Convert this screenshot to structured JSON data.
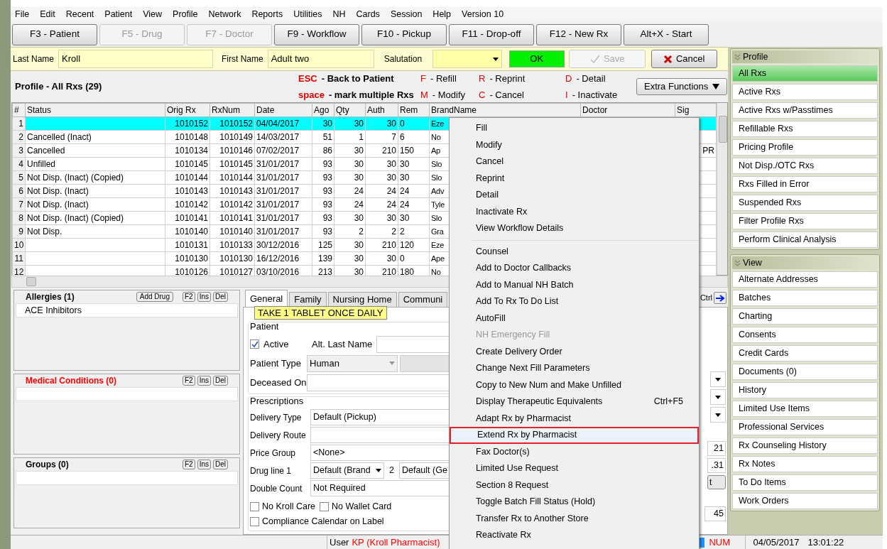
{
  "menu_bar": [
    "File",
    "Edit",
    "Recent",
    "Patient",
    "View",
    "Profile",
    "Network",
    "Reports",
    "Utilities",
    "NH",
    "Cards",
    "Session",
    "Help",
    "Version 10"
  ],
  "toolbar": [
    {
      "label": "F3 - Patient",
      "disabled": false
    },
    {
      "label": "F5 - Drug",
      "disabled": true
    },
    {
      "label": "F7 - Doctor",
      "disabled": true
    },
    {
      "label": "F9 - Workflow",
      "disabled": false
    },
    {
      "label": "F10 - Pickup",
      "disabled": false
    },
    {
      "label": "F11 - Drop-off",
      "disabled": false
    },
    {
      "label": "F12 - New Rx",
      "disabled": false
    },
    {
      "label": "Alt+X - Start",
      "disabled": false
    }
  ],
  "patient_bar": {
    "last_name_label": "Last Name",
    "last_name": "Kroll",
    "first_name_label": "First Name",
    "first_name": "Adult two",
    "salutation_label": "Salutation",
    "ok": "OK",
    "save": {
      "label": "Save",
      "disabled": true
    },
    "cancel": "Cancel"
  },
  "profile_title": "Profile - All Rxs (29)",
  "shortcuts": [
    {
      "key": "ESC",
      "label": "- Back to Patient",
      "bold": true
    },
    {
      "key": "F",
      "label": "- Refill",
      "bold": false
    },
    {
      "key": "R",
      "label": "- Reprint",
      "bold": false
    },
    {
      "key": "D",
      "label": "- Detail",
      "bold": false
    },
    {
      "key": "space",
      "label": "- mark multiple Rxs",
      "bold": true
    },
    {
      "key": "M",
      "label": "- Modify",
      "bold": false
    },
    {
      "key": "C",
      "label": "- Cancel",
      "bold": false
    },
    {
      "key": "I",
      "label": "- Inactivate",
      "bold": false
    }
  ],
  "extra_functions": "Extra Functions",
  "table": {
    "columns": [
      "#",
      "Status",
      "Orig Rx",
      "RxNum",
      "Date",
      "Ago",
      "Qty",
      "Auth",
      "Rem",
      "BrandName",
      "Doctor",
      "Sig"
    ],
    "rows": [
      {
        "selected": true,
        "cells": [
          "1",
          "",
          "1010152",
          "1010152",
          "04/04/2017",
          "30",
          "30",
          "30",
          "0",
          "Eze",
          "",
          ""
        ]
      },
      {
        "selected": false,
        "cells": [
          "2",
          "Cancelled (Inact)",
          "1010148",
          "1010149",
          "14/03/2017",
          "51",
          "1",
          "7",
          "6",
          "No",
          "",
          ""
        ]
      },
      {
        "selected": false,
        "cells": [
          "3",
          "Cancelled",
          "1010134",
          "1010146",
          "07/02/2017",
          "86",
          "30",
          "210",
          "150",
          "Ap",
          "",
          "PR"
        ]
      },
      {
        "selected": false,
        "cells": [
          "4",
          "Unfilled",
          "1010145",
          "1010145",
          "31/01/2017",
          "93",
          "30",
          "30",
          "30",
          "Slo",
          "",
          ""
        ]
      },
      {
        "selected": false,
        "cells": [
          "5",
          "Not Disp. (Inact) (Copied)",
          "1010144",
          "1010144",
          "31/01/2017",
          "93",
          "30",
          "30",
          "30",
          "Slo",
          "",
          ""
        ]
      },
      {
        "selected": false,
        "cells": [
          "6",
          "Not Disp. (Inact)",
          "1010143",
          "1010143",
          "31/01/2017",
          "93",
          "24",
          "24",
          "24",
          "Adv",
          "",
          ""
        ]
      },
      {
        "selected": false,
        "cells": [
          "7",
          "Not Disp. (Inact)",
          "1010142",
          "1010142",
          "31/01/2017",
          "93",
          "24",
          "24",
          "24",
          "Tyle",
          "",
          ""
        ]
      },
      {
        "selected": false,
        "cells": [
          "8",
          "Not Disp. (Inact) (Copied)",
          "1010141",
          "1010141",
          "31/01/2017",
          "93",
          "30",
          "30",
          "30",
          "Slo",
          "",
          ""
        ]
      },
      {
        "selected": false,
        "cells": [
          "9",
          "Not Disp.",
          "1010140",
          "1010140",
          "31/01/2017",
          "93",
          "2",
          "2",
          "2",
          "Gra",
          "",
          ""
        ]
      },
      {
        "selected": false,
        "cells": [
          "10",
          "",
          "1010131",
          "1010133",
          "30/12/2016",
          "125",
          "30",
          "210",
          "120",
          "Eze",
          "",
          ""
        ]
      },
      {
        "selected": false,
        "cells": [
          "11",
          "",
          "1010130",
          "1010130",
          "16/12/2016",
          "139",
          "30",
          "30",
          "0",
          "Ape",
          "",
          ""
        ]
      },
      {
        "selected": false,
        "cells": [
          "12",
          "",
          "1010126",
          "1010127",
          "03/10/2016",
          "213",
          "30",
          "210",
          "180",
          "No",
          "",
          ""
        ]
      }
    ]
  },
  "lists": [
    {
      "title": "Allergies (1)",
      "alert": false,
      "add_button": "Add Drug",
      "keys": [
        "F2",
        "Ins",
        "Del"
      ],
      "items": [
        "ACE Inhibitors"
      ]
    },
    {
      "title": "Medical Conditions (0)",
      "alert": true,
      "keys": [
        "F2",
        "Ins",
        "Del"
      ]
    },
    {
      "title": "Groups (0)",
      "alert": false,
      "keys": [
        "F2",
        "Ins",
        "Del"
      ]
    }
  ],
  "tabs": [
    {
      "label": "General",
      "selected": true
    },
    {
      "label": "Family",
      "selected": false
    },
    {
      "label": "Nursing Home",
      "selected": false
    },
    {
      "label": "Communi",
      "selected": false
    }
  ],
  "tooltip": "TAKE 1 TABLET ONCE DAILY",
  "patient_group": {
    "title": "Patient",
    "active": {
      "label": "Active",
      "checked": true
    },
    "alt_last_name": "Alt. Last Name",
    "patient_type_label": "Patient Type",
    "patient_type": "Human",
    "deceased_on": "Deceased On"
  },
  "prescriptions": {
    "title": "Prescriptions",
    "fields": [
      {
        "label": "Delivery Type",
        "value": "Default (Pickup)"
      },
      {
        "label": "Delivery Route"
      },
      {
        "label": "Price Group",
        "value": "<None>"
      }
    ],
    "drug_line_label": "Drug line 1",
    "drug_line_1": "Default (Brand",
    "drug_line_2_label": "2",
    "drug_line_2": "Default (Ge",
    "double_count_label": "Double Count",
    "double_count": "Not Required",
    "checkboxes": [
      {
        "label": "No Kroll Care",
        "checked": false
      },
      {
        "label": "No Wallet Card",
        "checked": false
      },
      {
        "label": "Compliance Calendar on Label",
        "checked": false
      }
    ]
  },
  "right_edge": {
    "ctrl": "Ctrl",
    "values": [
      "21",
      ".31"
    ],
    "button": "t",
    "count": "45"
  },
  "context_menu": [
    {
      "label": "Fill",
      "disabled": false,
      "selected": false
    },
    {
      "label": "Modify",
      "disabled": false,
      "selected": false
    },
    {
      "label": "Cancel",
      "disabled": false,
      "selected": false
    },
    {
      "label": "Reprint",
      "disabled": false,
      "selected": false
    },
    {
      "label": "Detail",
      "disabled": false,
      "selected": false
    },
    {
      "label": "Inactivate Rx",
      "disabled": false,
      "selected": false
    },
    {
      "label": "View Workflow Details",
      "disabled": false,
      "selected": false
    },
    {
      "kind": "separator"
    },
    {
      "label": "Counsel",
      "disabled": false,
      "selected": false
    },
    {
      "label": "Add to Doctor Callbacks",
      "disabled": false,
      "selected": false
    },
    {
      "label": "Add to Manual NH Batch",
      "disabled": false,
      "selected": false
    },
    {
      "label": "Add To Rx To Do List",
      "disabled": false,
      "selected": false
    },
    {
      "label": "AutoFill",
      "disabled": false,
      "selected": false
    },
    {
      "label": "NH Emergency Fill",
      "disabled": true,
      "selected": false
    },
    {
      "label": "Create Delivery Order",
      "disabled": false,
      "selected": false
    },
    {
      "label": "Change Next Fill Parameters",
      "disabled": false,
      "selected": false
    },
    {
      "label": "Copy to New Num and Make Unfilled",
      "disabled": false,
      "selected": false
    },
    {
      "label": "Display Therapeutic Equivalents",
      "shortcut": "Ctrl+F5",
      "disabled": false,
      "selected": false
    },
    {
      "label": "Adapt Rx by Pharmacist",
      "disabled": false,
      "selected": false
    },
    {
      "label": "Extend Rx by Pharmacist",
      "disabled": false,
      "selected": true
    },
    {
      "label": "Fax Doctor(s)",
      "disabled": false,
      "selected": false
    },
    {
      "label": "Limited Use Request",
      "disabled": false,
      "selected": false
    },
    {
      "label": "Section 8 Request",
      "disabled": false,
      "selected": false
    },
    {
      "label": "Toggle Batch Fill Status (Hold)",
      "disabled": false,
      "selected": false
    },
    {
      "label": "Transfer Rx to Another Store",
      "disabled": false,
      "selected": false
    },
    {
      "label": "Reactivate Rx",
      "disabled": false,
      "selected": false
    }
  ],
  "side_panels": [
    {
      "title": "Profile",
      "items": [
        {
          "label": "All Rxs",
          "selected": true
        },
        {
          "label": "Active Rxs",
          "selected": false
        },
        {
          "label": "Active Rxs w/Passtimes",
          "selected": false
        },
        {
          "label": "Refillable Rxs",
          "selected": false
        },
        {
          "label": "Pricing Profile",
          "selected": false
        },
        {
          "label": "Not Disp./OTC Rxs",
          "selected": false
        },
        {
          "label": "Rxs Filled in Error",
          "selected": false
        },
        {
          "label": "Suspended Rxs",
          "selected": false
        },
        {
          "label": "Filter Profile Rxs",
          "selected": false
        },
        {
          "label": "Perform Clinical Analysis",
          "selected": false
        }
      ]
    },
    {
      "title": "View",
      "items": [
        {
          "label": "Alternate Addresses",
          "selected": false
        },
        {
          "label": "Batches",
          "selected": false
        },
        {
          "label": "Charting",
          "selected": false
        },
        {
          "label": "Consents",
          "selected": false
        },
        {
          "label": "Credit Cards",
          "selected": false
        },
        {
          "label": "Documents (0)",
          "selected": false
        },
        {
          "label": "History",
          "selected": false
        },
        {
          "label": "Limited Use Items",
          "selected": false
        },
        {
          "label": "Professional Services",
          "selected": false
        },
        {
          "label": "Rx Counseling History",
          "selected": false
        },
        {
          "label": "Rx Notes",
          "selected": false
        },
        {
          "label": "To Do Items",
          "selected": false
        },
        {
          "label": "Work Orders",
          "selected": false
        }
      ]
    }
  ],
  "status_bar": {
    "user_label": "User",
    "user": "KP (Kroll Pharmacist)",
    "num": "NUM",
    "date": "04/05/2017",
    "time": "13:01:22"
  }
}
